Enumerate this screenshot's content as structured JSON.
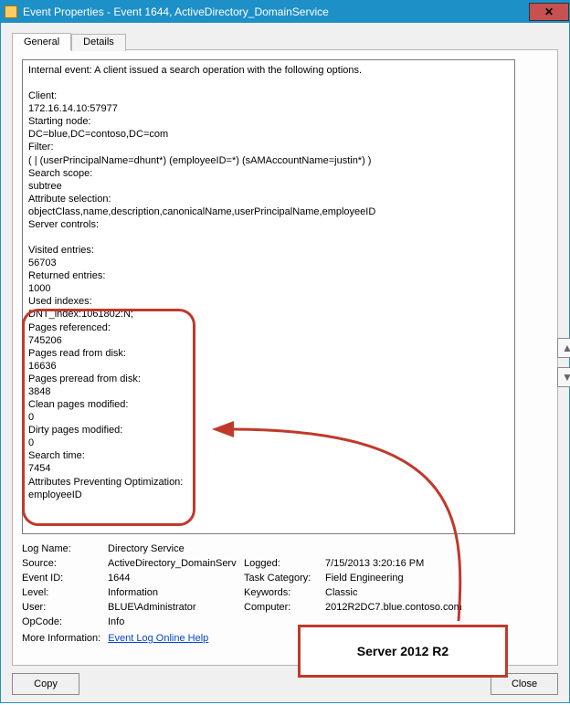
{
  "window": {
    "title": "Event Properties - Event 1644, ActiveDirectory_DomainService"
  },
  "tabs": {
    "general": "General",
    "details": "Details"
  },
  "event_body": "Internal event: A client issued a search operation with the following options.\n\nClient:\n172.16.14.10:57977\nStarting node:\nDC=blue,DC=contoso,DC=com\nFilter:\n ( |  (userPrincipalName=dhunt*)  (employeeID=*)  (sAMAccountName=justin*) )\nSearch scope:\nsubtree\nAttribute selection:\nobjectClass,name,description,canonicalName,userPrincipalName,employeeID\nServer controls:\n\nVisited entries:\n56703\nReturned entries:\n1000\nUsed indexes:\nDNT_index:1061802:N;\nPages referenced:\n745206\nPages read from disk:\n16636\nPages preread from disk:\n3848\nClean pages modified:\n0\nDirty pages modified:\n0\nSearch time:\n7454\nAttributes Preventing Optimization:\nemployeeID",
  "fields": {
    "log_name_label": "Log Name:",
    "log_name": "Directory Service",
    "source_label": "Source:",
    "source": "ActiveDirectory_DomainServ",
    "logged_label": "Logged:",
    "logged": "7/15/2013 3:20:16 PM",
    "event_id_label": "Event ID:",
    "event_id": "1644",
    "task_cat_label": "Task Category:",
    "task_cat": "Field Engineering",
    "level_label": "Level:",
    "level": "Information",
    "keywords_label": "Keywords:",
    "keywords": "Classic",
    "user_label": "User:",
    "user": "BLUE\\Administrator",
    "computer_label": "Computer:",
    "computer": "2012R2DC7.blue.contoso.com",
    "opcode_label": "OpCode:",
    "opcode": "Info",
    "moreinfo_label": "More Information:",
    "moreinfo_link": "Event Log Online Help"
  },
  "buttons": {
    "copy": "Copy",
    "close": "Close"
  },
  "annotation": {
    "label": "Server 2012 R2"
  }
}
